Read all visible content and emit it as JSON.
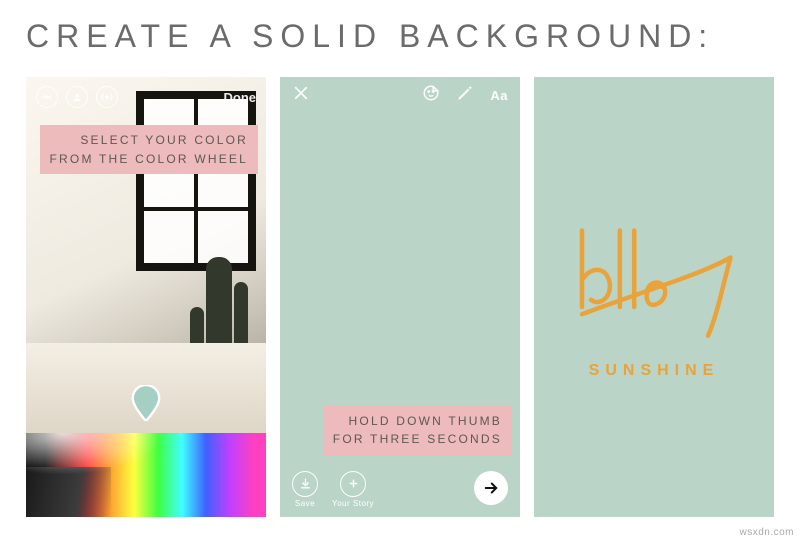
{
  "title": "CREATE A SOLID BACKGROUND:",
  "phone1": {
    "toolbar": {
      "live_icon": "live-icon",
      "person_icon": "person-icon",
      "broadcast_icon": "broadcast-icon",
      "done_label": "Done"
    },
    "callout": {
      "line1": "SELECT YOUR COLOR",
      "line2": "FROM THE COLOR WHEEL"
    },
    "pin_color": "#a5cfc3"
  },
  "phone2": {
    "bg_color": "#bad5c7",
    "toolbar": {
      "close_icon": "close-icon",
      "sticker_icon": "sticker-icon",
      "draw_icon": "draw-icon",
      "text_label": "Aa"
    },
    "callout": {
      "line1": "HOLD DOWN THUMB",
      "line2": "FOR THREE SECONDS"
    },
    "bottom": {
      "save_label": "Save",
      "story_label": "Your Story",
      "send_icon": "arrow-right-icon"
    }
  },
  "phone3": {
    "bg_color": "#bad5c7",
    "script_text": "hello",
    "sub_text": "SUNSHINE",
    "text_color": "#e9a33a"
  },
  "watermark": "wsxdn.com"
}
